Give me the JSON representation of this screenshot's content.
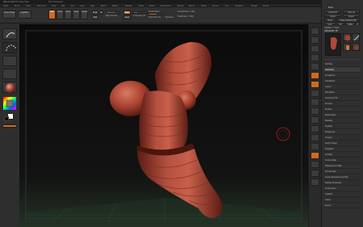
{
  "window": {
    "title": "ZBrush 2021.5.1 Core Trial",
    "menu_title": "Tool: Document"
  },
  "menu": [
    "Alpha",
    "Brush",
    "Color",
    "Document",
    "Draw",
    "Edit",
    "File",
    "Layer",
    "Light",
    "Macro",
    "Marker",
    "Material",
    "Movie",
    "Picker",
    "Preferences",
    "Render",
    "Stencil",
    "Stroke",
    "Texture",
    "Tool",
    "Transform",
    "Zplugin",
    "Zscript"
  ],
  "shelf": {
    "home_page": "Home Page",
    "lightbox": "LightBox",
    "edit": "Edit",
    "draw": "Draw",
    "move": "Move",
    "scale": "Scale",
    "rotate": "Rotate",
    "mrgb": "Mrgb",
    "rgb": "Rgb",
    "m": "M",
    "rgb_intensity": "Rgb Intensity",
    "zadd": "Zadd",
    "zsub": "Zsub",
    "focal_shift": "Focal Shift 0",
    "draw_size": "Draw Size 64",
    "dynamic": "Dynamic",
    "z_intensity": "Z Intensity 25",
    "active_points": "ActivePoints: 7,464",
    "total_points": "TotalPoints: 7,464"
  },
  "colors": {
    "accent": "#d16a1d",
    "model": "#b04a3a",
    "floor": "#3f6e4c"
  },
  "right_shelf": [
    "bpr-icon",
    "spix-icon",
    "scroll-icon",
    "zoom-icon",
    "actual-icon",
    "aahalf-icon",
    "persp-icon",
    "floor-icon",
    "local-icon",
    "xyz-icon",
    "frame-icon",
    "move-icon",
    "scale-icon",
    "rotate-icon",
    "polyf-icon",
    "transp-icon",
    "ghost-icon",
    "solo-icon",
    "xpose-icon"
  ],
  "tray": {
    "header": "Tool",
    "buttons": [
      "Load Tool",
      "Save As",
      "Import",
      "Export",
      "Clone",
      "Make PolyMesh3D",
      "GoZ",
      "All",
      "Visible",
      "R"
    ],
    "lightbox_tools": "Lightbox > Tools",
    "current_tool": "Cylinder3D. 48",
    "subtools": [
      "Cylinder3D",
      "PolyMesh3D",
      "SimpleBrush",
      "Cylinder3D"
    ],
    "menu_items": [
      "SubTool",
      "Geometry",
      "ArrayMesh",
      "NanoMesh",
      "Layers",
      "FiberMesh",
      "Geometry HD",
      "Preview",
      "Surface",
      "Deformation",
      "Masking",
      "Visibility",
      "Polygroups",
      "Contact",
      "Morph Target",
      "Polypaint",
      "UV Map",
      "Texture Map",
      "Displacement Map",
      "Normal Map",
      "Vector Displacement Map",
      "Display Properties",
      "Unified Skin",
      "Initialize",
      "Import",
      "Export"
    ],
    "active_item": "Geometry"
  },
  "stroke_label": "DragRect",
  "alpha_label": "Alpha Off",
  "material_label": "MatCap Red Wax"
}
